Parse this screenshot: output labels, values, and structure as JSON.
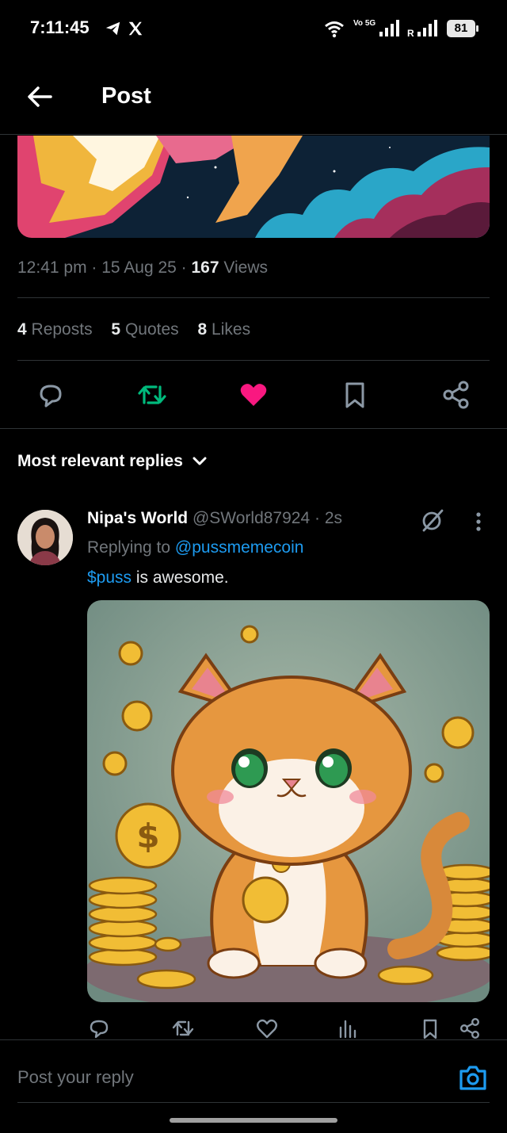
{
  "status_bar": {
    "time": "7:11:45",
    "network_label": "Vo 5G",
    "roaming": "R",
    "battery": "81"
  },
  "header": {
    "title": "Post"
  },
  "post": {
    "time": "12:41 pm",
    "date": "15 Aug 25",
    "views_count": "167",
    "views_label": "Views",
    "reposts_count": "4",
    "reposts_label": "Reposts",
    "quotes_count": "5",
    "quotes_label": "Quotes",
    "likes_count": "8",
    "likes_label": "Likes",
    "liked": true,
    "colors": {
      "repost": "#00ba7c",
      "like": "#f91880",
      "link": "#1d9bf0"
    }
  },
  "replies_sort": {
    "label": "Most relevant replies"
  },
  "reply": {
    "name": "Nipa's World",
    "handle": "@SWorld87924",
    "time": "2s",
    "replying_prefix": "Replying to",
    "replying_to": "@pussmemecoin",
    "cashtag": "$puss",
    "text": " is awesome."
  },
  "composer": {
    "placeholder": "Post your reply"
  },
  "icons": [
    "back-arrow-icon",
    "telegram-icon",
    "x-logo-icon",
    "wifi-icon",
    "signal-icon",
    "reply-icon",
    "repost-icon",
    "heart-icon",
    "bookmark-icon",
    "share-icon",
    "chevron-down-icon",
    "grok-icon",
    "more-icon",
    "views-icon",
    "camera-icon"
  ]
}
